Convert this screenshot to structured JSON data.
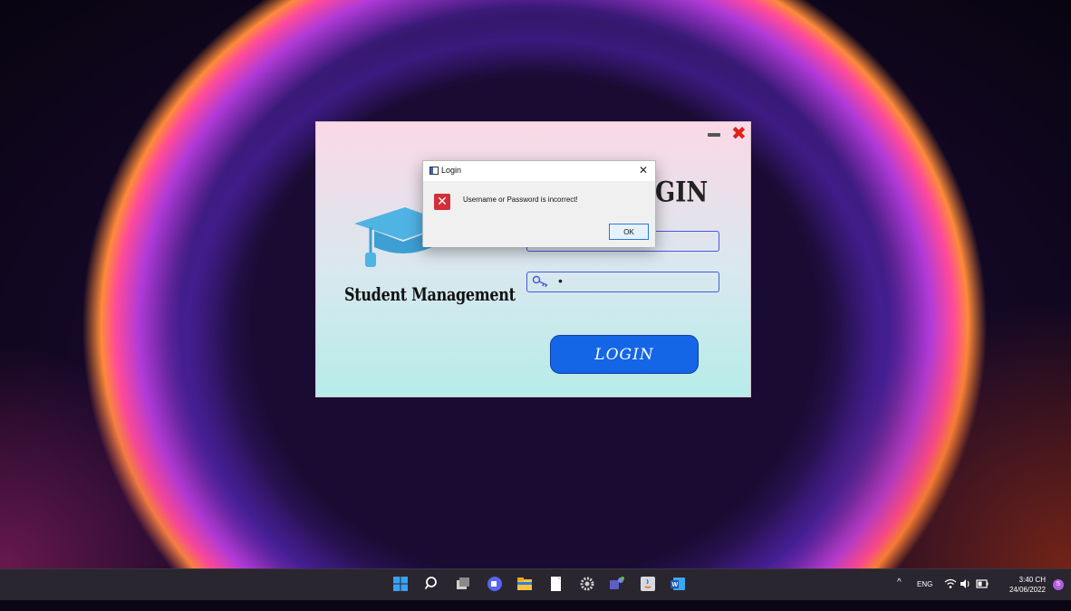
{
  "app": {
    "brand": "Student Management",
    "title": "GIN",
    "password_value": "•",
    "login_label": "LOGIN"
  },
  "dialog": {
    "title": "Login",
    "message": "Username or Password is incorrect!",
    "ok_label": "OK",
    "close_glyph": "✕",
    "error_glyph": "✕"
  },
  "taskbar": {
    "icons": [
      "windows-start-icon",
      "search-icon",
      "task-view-icon",
      "chat-icon",
      "file-explorer-icon",
      "notepad-icon",
      "settings-icon",
      "teams-icon",
      "java-app-icon",
      "word-icon"
    ],
    "tray": {
      "chevron": "^",
      "language": "ENG",
      "time": "3:40 CH",
      "date": "24/06/2022",
      "notification_count": "5"
    }
  },
  "colors": {
    "accent_button": "#1466e6",
    "error_red": "#d0303a",
    "close_red": "#e0201a"
  }
}
